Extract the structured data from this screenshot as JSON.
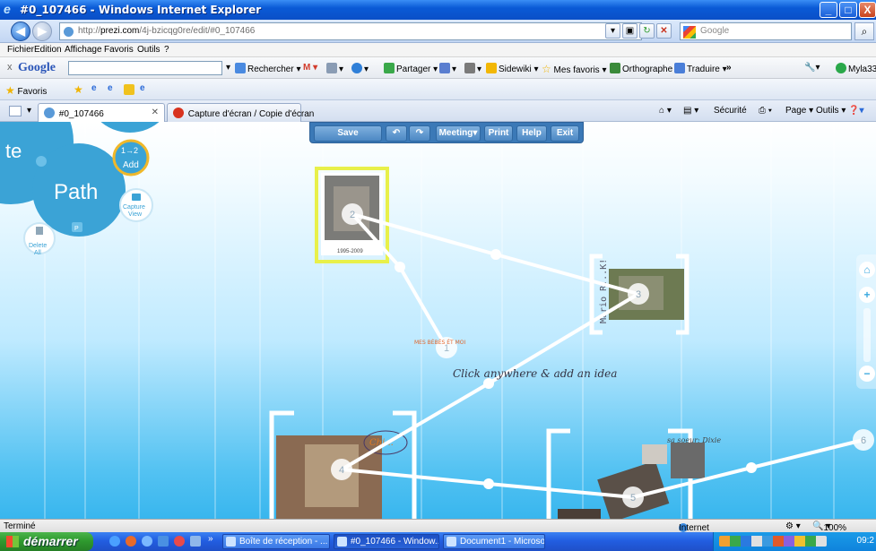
{
  "window": {
    "title": "#0_107466 - Windows Internet Explorer",
    "controls": {
      "minimize": "_",
      "maximize": "□",
      "close": "X"
    }
  },
  "address_bar": {
    "url_prefix": "http://",
    "url_domain": "prezi.com",
    "url_path": "/4j-bzicqg0re/edit/#0_107466",
    "search_placeholder": "Google"
  },
  "menu": [
    "Fichier",
    "Edition",
    "Affichage",
    "Favoris",
    "Outils",
    "?"
  ],
  "google_toolbar": {
    "logo": "Google",
    "items": [
      "Rechercher",
      "Partager",
      "Sidewiki",
      "Mes favoris",
      "Orthographe",
      "Traduire",
      "»"
    ],
    "user": "Myla33"
  },
  "favorites_bar": {
    "label": "Favoris"
  },
  "tabs": [
    {
      "label": "#0_107466",
      "active": true
    },
    {
      "label": "Capture d'écran / Copie d'écran",
      "active": false
    }
  ],
  "command_bar": [
    "Sécurité",
    "Page",
    "Outils"
  ],
  "prezi": {
    "toolbar": [
      "Save",
      "Meeting",
      "Print",
      "Help",
      "Exit"
    ],
    "bubble_menu": {
      "top_fragment": "te",
      "path_label": "Path",
      "add_label": "Add",
      "add_badge": "1→2",
      "capture_label": "Capture View",
      "delete_label": "Delete All",
      "p_key": "P"
    },
    "canvas_hint": "Click anywhere & add an idea",
    "path_numbers": [
      "1",
      "2",
      "3",
      "4",
      "5",
      "6"
    ],
    "frame_texts": {
      "cat1_caption": "1995-2009",
      "mario_label": "Mario R...K!",
      "sister_label": "sa soeur: Dixie",
      "scribble_label": "Chi...",
      "red_note": "MES BÉBÉS ÉT MOI"
    },
    "right_nav": [
      "home",
      "zoom-in",
      "zoom-out"
    ]
  },
  "status_bar": {
    "left": "Terminé",
    "zone": "Internet",
    "zoom": "100%"
  },
  "taskbar": {
    "start": "démarrer",
    "items": [
      {
        "label": "Boîte de réception - ...",
        "active": false
      },
      {
        "label": "#0_107466 - Window...",
        "active": true
      },
      {
        "label": "Document1 - Microsof...",
        "active": false
      }
    ],
    "clock": "09:2"
  },
  "colors": {
    "title_bar": "#0a5ad6",
    "prezi_toolbar": "#3b79b7",
    "path_line": "#ffffff",
    "selection": "#e8f04a",
    "taskbar": "#225ee1",
    "start_button": "#2f9a2f"
  }
}
